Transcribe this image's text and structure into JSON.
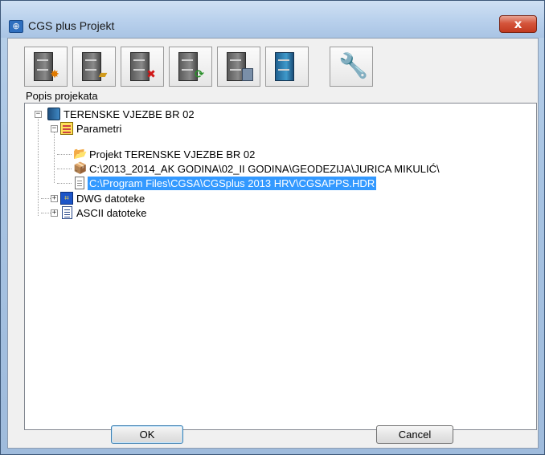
{
  "window": {
    "title": "CGS plus Projekt",
    "app_icon": "cgs-app-icon",
    "close_label": "x"
  },
  "toolbar": {
    "buttons": [
      {
        "name": "new-project-button",
        "icon": "cabinet-new-icon"
      },
      {
        "name": "open-project-button",
        "icon": "cabinet-open-icon"
      },
      {
        "name": "delete-project-button",
        "icon": "cabinet-delete-icon"
      },
      {
        "name": "refresh-project-button",
        "icon": "cabinet-refresh-icon"
      },
      {
        "name": "copy-project-button",
        "icon": "cabinet-document-icon"
      },
      {
        "name": "project-cabinet-button",
        "icon": "cabinet-blue-icon"
      },
      {
        "name": "settings-button",
        "icon": "wrench-icon"
      }
    ]
  },
  "project_list": {
    "label": "Popis projekata",
    "tree": {
      "root": "TERENSKE VJEZBE BR 02",
      "parametri": "Parametri",
      "param_items": [
        "Projekt  TERENSKE VJEZBE BR 02",
        "C:\\2013_2014_AK GODINA\\02_II GODINA\\GEODEZIJA\\JURICA MIKULIĆ\\",
        "C:\\Program Files\\CGSA\\CGSplus 2013 HRV\\CGSAPPS.HDR"
      ],
      "dwg": "DWG datoteke",
      "ascii": "ASCII datoteke"
    }
  },
  "buttons": {
    "ok": "OK",
    "cancel": "Cancel"
  },
  "colors": {
    "selection": "#3399ff",
    "close": "#c23a20"
  }
}
